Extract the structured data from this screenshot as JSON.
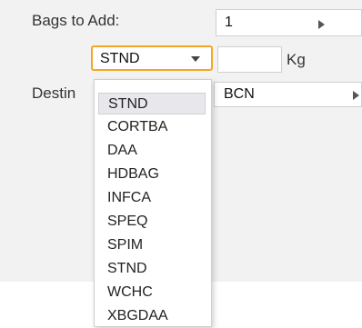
{
  "form": {
    "bags_label": "Bags to Add:",
    "bags_value": "1",
    "bag_type_selected": "STND",
    "weight_value": "",
    "weight_unit": "Kg",
    "destination_label": "Destin",
    "destination_value": "BCN"
  },
  "dropdown": {
    "options": [
      "STND",
      "CORTBA",
      "DAA",
      "HDBAG",
      "INFCA",
      "SPEQ",
      "SPIM",
      "STND",
      "WCHC",
      "XBGDAA"
    ],
    "highlighted_index": 0
  },
  "icons": {
    "bags_stepper": "triangle-right-icon",
    "destination_stepper": "triangle-right-icon",
    "select_arrow": "chevron-down-icon"
  },
  "colors": {
    "focus_border": "#f5a623",
    "panel_bg": "#f2f2f2",
    "highlight_bg": "#e8e8ec"
  }
}
